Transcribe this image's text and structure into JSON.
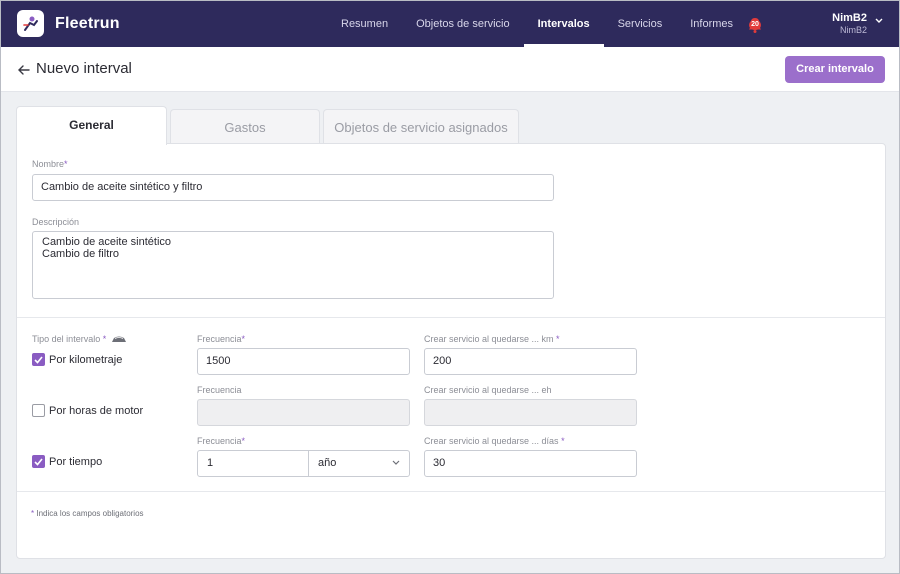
{
  "app": {
    "name": "Fleetrun"
  },
  "nav": {
    "items": [
      "Resumen",
      "Objetos de servicio",
      "Intervalos",
      "Servicios",
      "Informes"
    ],
    "active": "Intervalos",
    "notification_count": "20"
  },
  "user": {
    "name": "NimB2",
    "account": "NimB2"
  },
  "page": {
    "title": "Nuevo interval",
    "create_button": "Crear intervalo"
  },
  "tabs": [
    "General",
    "Gastos",
    "Objetos de servicio asignados"
  ],
  "form": {
    "name_label": "Nombre",
    "name_value": "Cambio de aceite sintético y filtro",
    "description_label": "Descripción",
    "description_lines": [
      "Cambio de aceite sintético",
      "Cambio de filtro"
    ],
    "interval_type_label": "Tipo del intervalo",
    "mileage": {
      "label": "Por kilometraje",
      "checked": true,
      "freq_label": "Frecuencia",
      "freq_value": "1500",
      "remain_label": "Crear servicio al quedarse ... km",
      "remain_value": "200"
    },
    "engine_hours": {
      "label": "Por horas de motor",
      "checked": false,
      "freq_label": "Frecuencia",
      "freq_value": "",
      "remain_label": "Crear servicio al quedarse ... eh",
      "remain_value": ""
    },
    "time": {
      "label": "Por tiempo",
      "checked": true,
      "freq_label": "Frecuencia",
      "freq_value": "1",
      "unit_value": "año",
      "remain_label": "Crear servicio al quedarse ... días",
      "remain_value": "30"
    },
    "required_note": "Indica los campos obligatorios"
  },
  "colors": {
    "navbar": "#2e2a5c",
    "accent": "#8a5cc2",
    "button": "#9b6fcb",
    "badge": "#e23b3b"
  }
}
